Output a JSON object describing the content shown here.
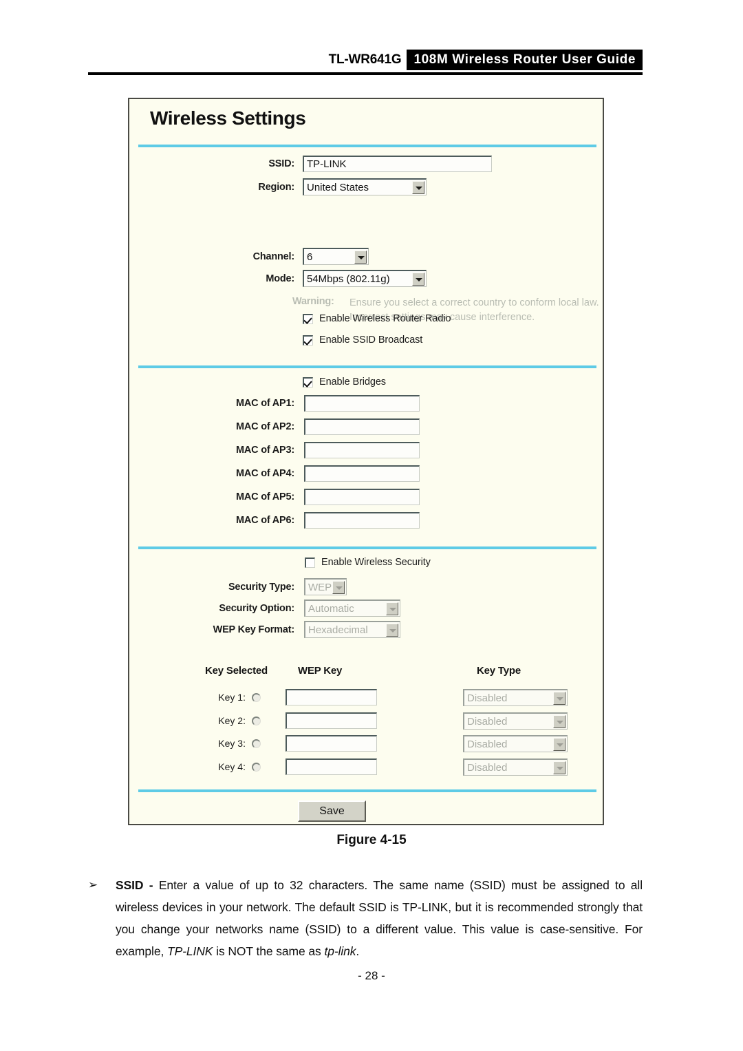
{
  "header": {
    "model": "TL-WR641G",
    "guide_title": "108M Wireless Router User Guide"
  },
  "panel": {
    "title": "Wireless Settings",
    "basic": {
      "ssid_label": "SSID:",
      "ssid_value": "TP-LINK",
      "region_label": "Region:",
      "region_value": "United States",
      "warning_label": "Warning:",
      "warning_text": "Ensure you select a correct country to conform local law. Incorrect settings may cause interference.",
      "channel_label": "Channel:",
      "channel_value": "6",
      "mode_label": "Mode:",
      "mode_value": "54Mbps (802.11g)",
      "enable_radio_label": "Enable Wireless Router Radio",
      "enable_radio_checked": "checked",
      "enable_broadcast_label": "Enable SSID Broadcast",
      "enable_broadcast_checked": "checked"
    },
    "bridges": {
      "enable_label": "Enable Bridges",
      "enable_checked": "checked",
      "aps": [
        {
          "label": "MAC of AP1:",
          "value": ""
        },
        {
          "label": "MAC of AP2:",
          "value": ""
        },
        {
          "label": "MAC of AP3:",
          "value": ""
        },
        {
          "label": "MAC of AP4:",
          "value": ""
        },
        {
          "label": "MAC of AP5:",
          "value": ""
        },
        {
          "label": "MAC of AP6:",
          "value": ""
        }
      ]
    },
    "security": {
      "enable_label": "Enable Wireless Security",
      "enable_checked": "",
      "type_label": "Security Type:",
      "type_value": "WEP",
      "option_label": "Security Option:",
      "option_value": "Automatic",
      "format_label": "WEP Key Format:",
      "format_value": "Hexadecimal",
      "col_key_selected": "Key Selected",
      "col_wep_key": "WEP Key",
      "col_key_type": "Key Type",
      "keys": [
        {
          "label": "Key 1:",
          "value": "",
          "type": "Disabled",
          "selected": ""
        },
        {
          "label": "Key 2:",
          "value": "",
          "type": "Disabled",
          "selected": ""
        },
        {
          "label": "Key 3:",
          "value": "",
          "type": "Disabled",
          "selected": ""
        },
        {
          "label": "Key 4:",
          "value": "",
          "type": "Disabled",
          "selected": ""
        }
      ]
    },
    "save_label": "Save"
  },
  "figure": {
    "caption": "Figure 4-15"
  },
  "body": {
    "bullet_mark": "➢",
    "term": "SSID -",
    "text_1": " Enter a value of up to 32 characters. The same name (SSID) must be assigned to all wireless devices in your network. The default SSID is TP-LINK, but it is recommended strongly that you change your networks name (SSID) to a different value. This value is case-sensitive. For example, ",
    "italic_1": "TP-LINK",
    "text_2": " is NOT the same as ",
    "italic_2": "tp-link",
    "text_3": "."
  },
  "footer": {
    "page_number": "- 28 -"
  }
}
